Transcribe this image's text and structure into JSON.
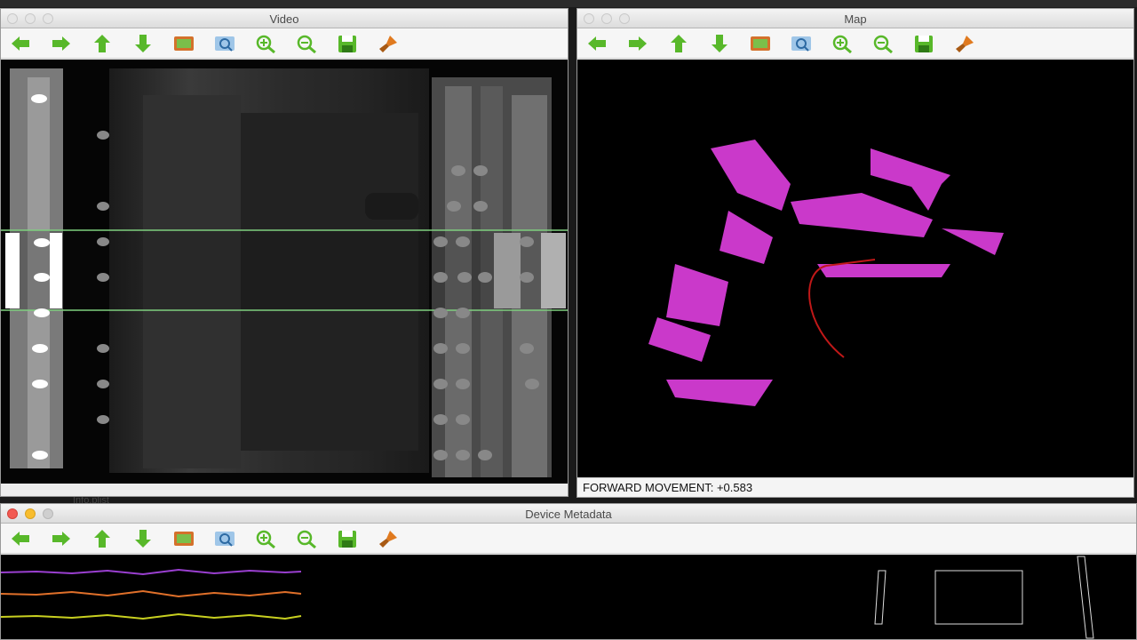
{
  "windows": {
    "video": {
      "title": "Video"
    },
    "map": {
      "title": "Map",
      "status_text": "FORWARD MOVEMENT: +0.583"
    },
    "metadata": {
      "title": "Device Metadata"
    }
  },
  "background": {
    "file_label": "Info.plist"
  },
  "toolbar_tools": [
    {
      "name": "arrow-left-icon",
      "color": "#58b82a"
    },
    {
      "name": "arrow-right-icon",
      "color": "#58b82a"
    },
    {
      "name": "arrow-up-icon",
      "color": "#58b82a"
    },
    {
      "name": "arrow-down-icon",
      "color": "#58b82a"
    },
    {
      "name": "image-view-icon",
      "color": "#d4712b"
    },
    {
      "name": "fit-view-icon",
      "color": "#4a8fcf"
    },
    {
      "name": "zoom-in-icon",
      "color": "#58b82a"
    },
    {
      "name": "zoom-out-icon",
      "color": "#58b82a"
    },
    {
      "name": "save-icon",
      "color": "#58b82a"
    },
    {
      "name": "clear-icon",
      "color": "#e07a1f"
    }
  ],
  "colors": {
    "map_points": "#e040e0",
    "trajectory": "#c01818",
    "scan_line": "#7fd07f",
    "graph_purple": "#9a3fd0",
    "graph_orange": "#e0702a",
    "graph_yellow": "#c8d020"
  }
}
